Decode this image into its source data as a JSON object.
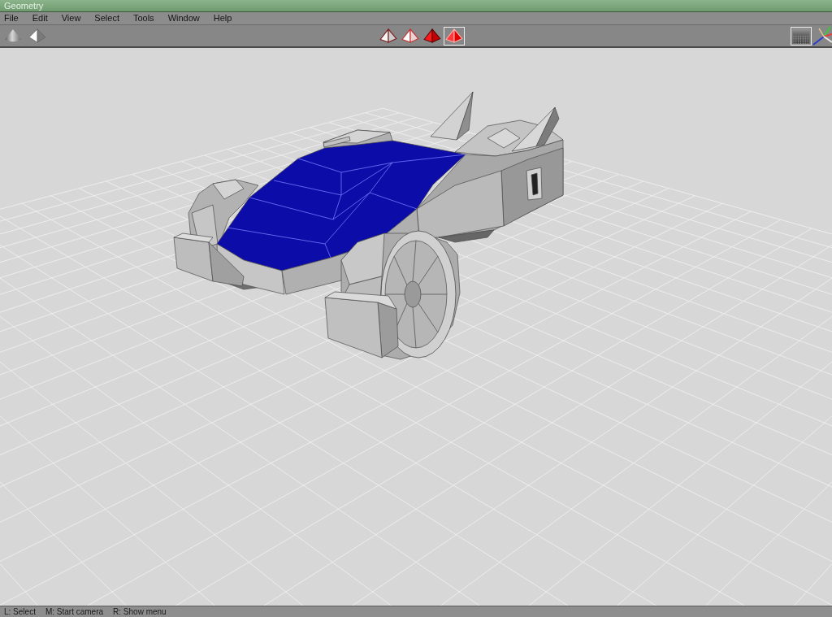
{
  "window": {
    "title": "Geometry"
  },
  "menu": [
    "File",
    "Edit",
    "View",
    "Select",
    "Tools",
    "Window",
    "Help"
  ],
  "toolbar": {
    "object_tools": [
      {
        "kind": "smooth"
      },
      {
        "kind": "faceted"
      }
    ],
    "shading_modes": [
      {
        "kind": "outline",
        "selected": false
      },
      {
        "kind": "hollow",
        "selected": false
      },
      {
        "kind": "filled",
        "selected": false
      },
      {
        "kind": "solid",
        "selected": true
      }
    ],
    "texture_toggle": {
      "on": true
    }
  },
  "status_bar": {
    "hints": [
      "L: Select",
      "M: Start camera",
      "R: Show menu"
    ]
  }
}
